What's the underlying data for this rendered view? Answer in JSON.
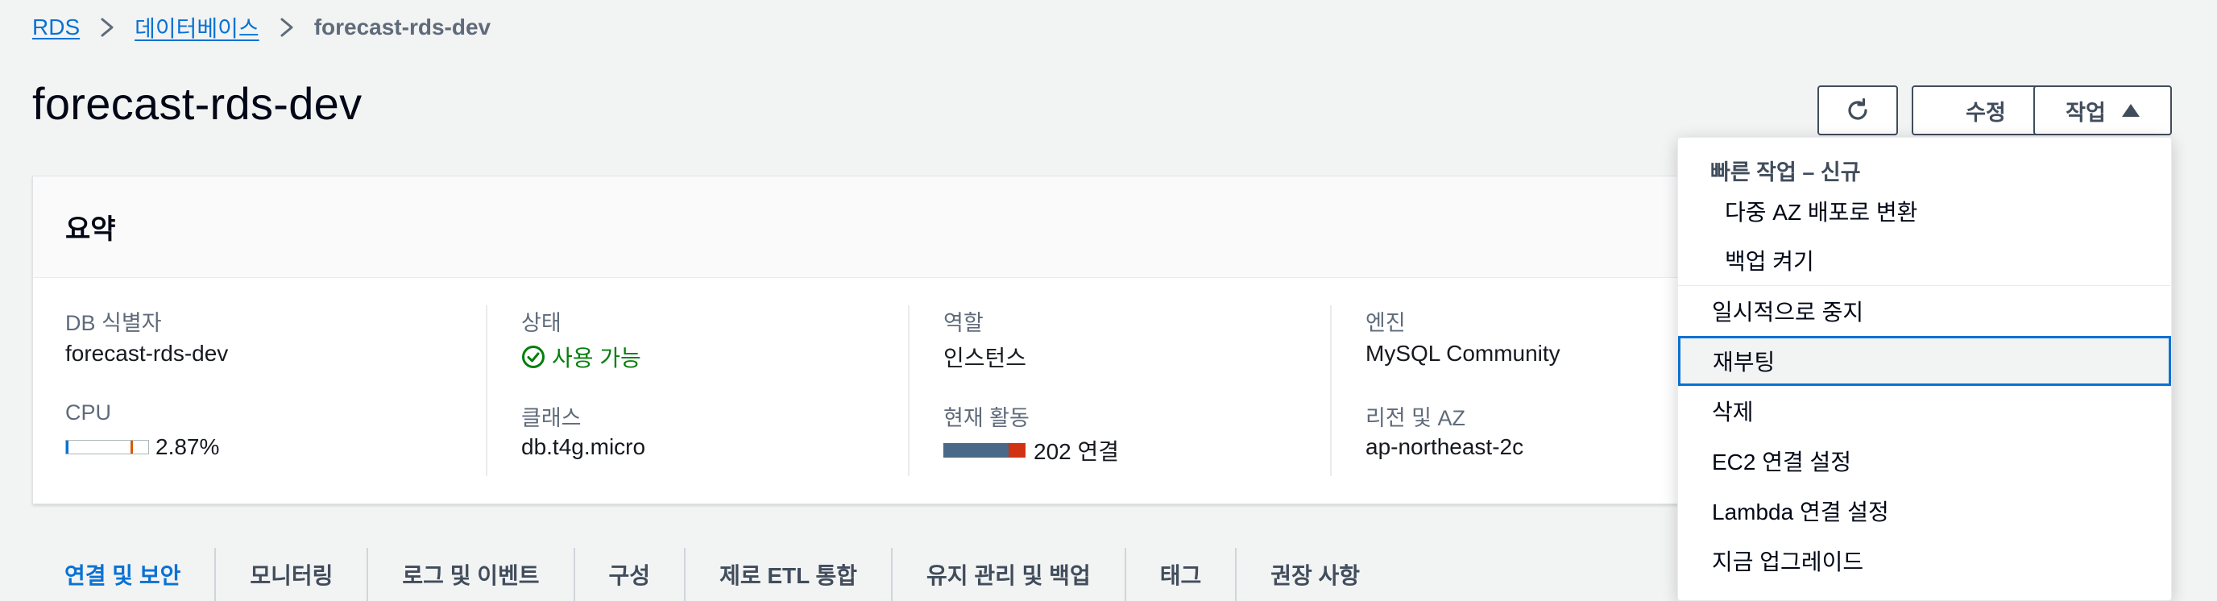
{
  "breadcrumb": {
    "items": [
      "RDS",
      "데이터베이스"
    ],
    "current": "forecast-rds-dev"
  },
  "page_title": "forecast-rds-dev",
  "header_buttons": {
    "refresh_icon": "refresh-icon",
    "edit_label": "수정",
    "actions_label": "작업"
  },
  "summary": {
    "title": "요약",
    "db_id_label": "DB 식별자",
    "db_id_value": "forecast-rds-dev",
    "cpu_label": "CPU",
    "cpu_value": "2.87%",
    "cpu_percent": 2.87,
    "status_label": "상태",
    "status_value": "사용 가능",
    "class_label": "클래스",
    "class_value": "db.t4g.micro",
    "role_label": "역할",
    "role_value": "인스턴스",
    "activity_label": "현재 활동",
    "activity_value": "202 연결",
    "engine_label": "엔진",
    "engine_value": "MySQL Community",
    "region_label": "리전 및 AZ",
    "region_value": "ap-northeast-2c"
  },
  "tabs": [
    {
      "label": "연결 및 보안",
      "active": true
    },
    {
      "label": "모니터링",
      "active": false
    },
    {
      "label": "로그 및 이벤트",
      "active": false
    },
    {
      "label": "구성",
      "active": false
    },
    {
      "label": "제로 ETL 통합",
      "active": false
    },
    {
      "label": "유지 관리 및 백업",
      "active": false
    },
    {
      "label": "태그",
      "active": false
    },
    {
      "label": "권장 사항",
      "active": false
    }
  ],
  "actions_menu": {
    "group_title": "빠른 작업 – 신규",
    "group_items": [
      "다중 AZ 배포로 변환",
      "백업 켜기"
    ],
    "items": [
      "일시적으로 중지",
      "재부팅",
      "삭제",
      "EC2 연결 설정",
      "Lambda 연결 설정",
      "지금 업그레이드"
    ],
    "focused_item": "재부팅"
  },
  "colors": {
    "link": "#0972d3",
    "success": "#037f0c",
    "text": "#16191f",
    "muted": "#5f6b7a",
    "bar_blue": "#4a6887",
    "bar_red": "#d13212"
  }
}
